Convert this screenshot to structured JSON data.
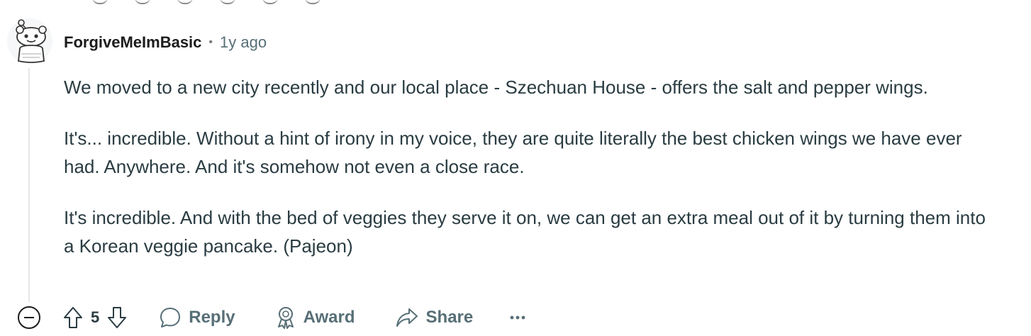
{
  "comment": {
    "username": "ForgiveMeImBasic",
    "separator": "•",
    "timestamp": "1y ago",
    "paragraphs": [
      "We moved to a new city recently and our local place - Szechuan House - offers the salt and pepper wings.",
      "It's... incredible. Without a hint of irony in my voice, they are quite literally the best chicken wings we have ever had. Anywhere. And it's somehow not even a close race.",
      "It's incredible. And with the bed of veggies they serve it on, we can get an extra meal out of it by turning them into a Korean veggie pancake. (Pajeon)"
    ]
  },
  "actions": {
    "vote_count": "5",
    "reply_label": "Reply",
    "award_label": "Award",
    "share_label": "Share",
    "more_label": "···"
  },
  "icons": {
    "collapse": "minus-circle-icon",
    "upvote": "arrow-up-icon",
    "downvote": "arrow-down-icon",
    "reply": "speech-bubble-icon",
    "award": "award-ribbon-icon",
    "share": "share-arrow-icon",
    "more": "ellipsis-icon",
    "avatar": "snoo-avatar-icon"
  },
  "colors": {
    "text_primary": "#1c1c1c",
    "text_body": "#2a3c42",
    "text_meta": "#576f76",
    "thread_line": "#e5e7ea"
  }
}
